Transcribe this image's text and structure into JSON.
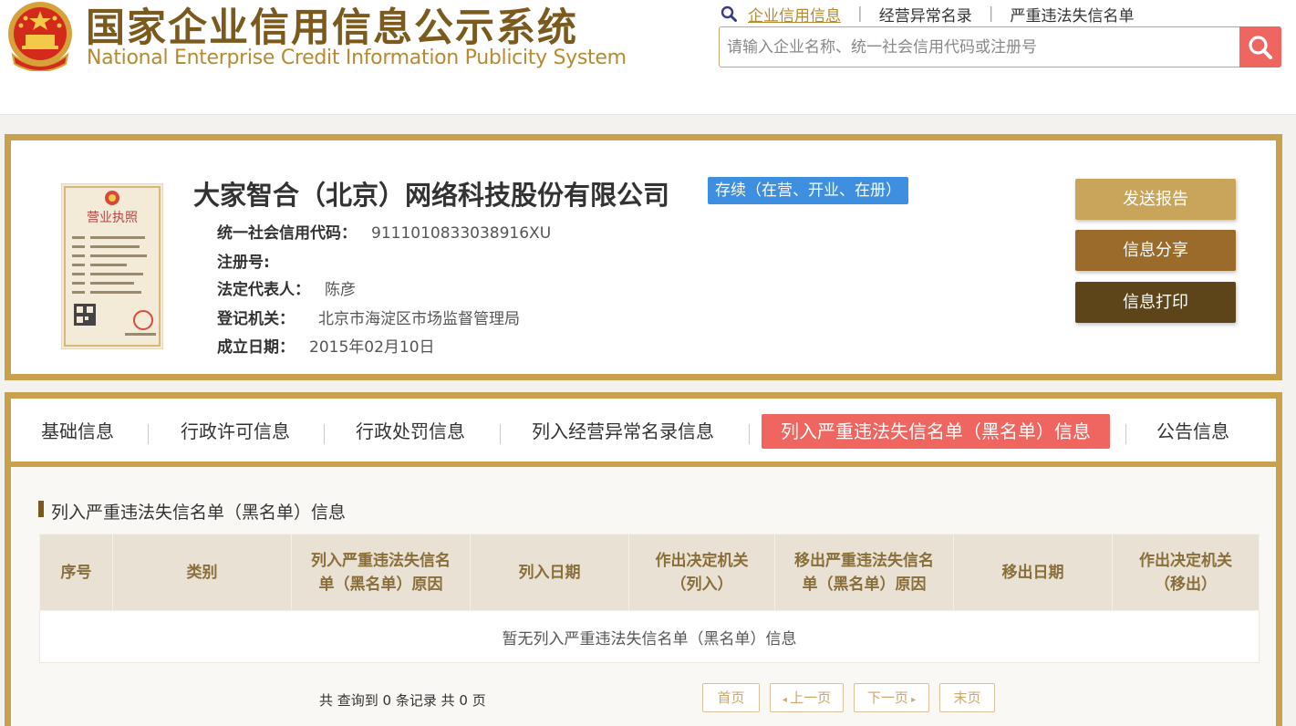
{
  "header": {
    "title_cn": "国家企业信用信息公示系统",
    "title_en": "National Enterprise Credit Information Publicity System",
    "nav": [
      "企业信用信息",
      "经营异常名录",
      "严重违法失信名单"
    ],
    "search_placeholder": "请输入企业名称、统一社会信用代码或注册号"
  },
  "license_image": {
    "title": "营业执照"
  },
  "company": {
    "name": "大家智合（北京）网络科技股份有限公司",
    "status": "存续（在营、开业、在册）",
    "credit_code_label": "统一社会信用代码：",
    "credit_code": "9111010833038916XU",
    "reg_no_label": "注册号:",
    "reg_no": "",
    "legal_rep_label": "法定代表人：",
    "legal_rep": "陈彦",
    "authority_label": "登记机关：",
    "authority": "北京市海淀区市场监督管理局",
    "founded_label": "成立日期：",
    "founded": "2015年02月10日"
  },
  "actions": {
    "send_report": "发送报告",
    "share": "信息分享",
    "print": "信息打印"
  },
  "tabs": [
    {
      "label": "基础信息"
    },
    {
      "label": "行政许可信息"
    },
    {
      "label": "行政处罚信息"
    },
    {
      "label": "列入经营异常名录信息"
    },
    {
      "label": "列入严重违法失信名单（黑名单）信息",
      "active": true
    },
    {
      "label": "公告信息"
    }
  ],
  "section": {
    "title": "列入严重违法失信名单（黑名单）信息",
    "columns": [
      "序号",
      "类别",
      "列入严重违法失信名单（黑名单）原因",
      "列入日期",
      "作出决定机关（列入）",
      "移出严重违法失信名单（黑名单）原因",
      "移出日期",
      "作出决定机关（移出）"
    ],
    "empty_text": "暂无列入严重违法失信名单（黑名单）信息"
  },
  "pager": {
    "summary": "共 查询到 0 条记录 共 0 页",
    "first": "首页",
    "prev": "上一页",
    "next": "下一页",
    "last": "末页"
  },
  "colors": {
    "brand_gold": "#c8a14f",
    "brand_brown": "#7b5a1d",
    "accent_red": "#ef6560",
    "status_blue": "#3e8fe0",
    "btn_report": "#c9a55c",
    "btn_share": "#9a6b2b",
    "btn_print": "#5e4519"
  },
  "icons": [
    "national-emblem-icon",
    "magnifier-icon",
    "search-icon",
    "left-arrow-icon",
    "right-arrow-icon"
  ]
}
